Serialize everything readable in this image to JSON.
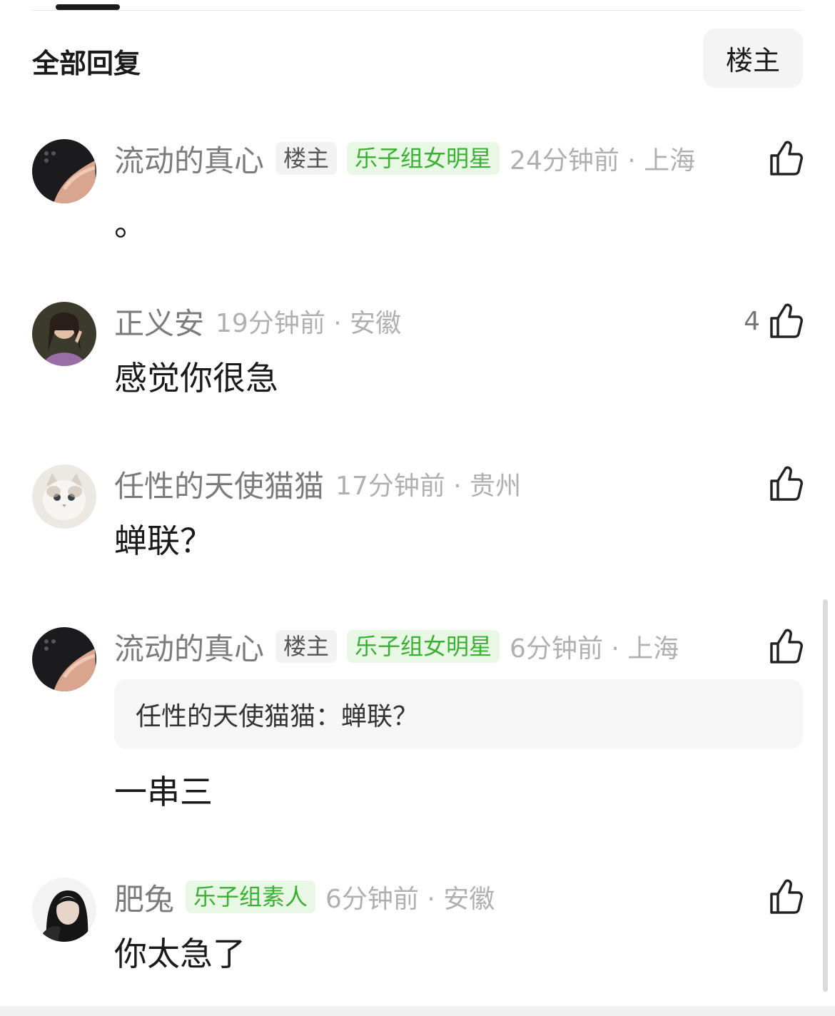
{
  "header": {
    "title": "全部回复",
    "filter_label": "楼主"
  },
  "comments": [
    {
      "username": "流动的真心",
      "badges": [
        "楼主",
        "乐子组女明星"
      ],
      "time": "24分钟前 · 上海",
      "likes": "",
      "text": "。"
    },
    {
      "username": "正义安",
      "badges": [],
      "time": "19分钟前 · 安徽",
      "likes": "4",
      "text": "感觉你很急"
    },
    {
      "username": "任性的天使猫猫",
      "badges": [],
      "time": "17分钟前 · 贵州",
      "likes": "",
      "text": "蝉联？"
    },
    {
      "username": "流动的真心",
      "badges": [
        "楼主",
        "乐子组女明星"
      ],
      "time": "6分钟前 · 上海",
      "likes": "",
      "quote": {
        "author": "任性的天使猫猫：",
        "text": "蝉联？"
      },
      "text": "一串三"
    },
    {
      "username": "肥兔",
      "badges": [
        "乐子组素人"
      ],
      "time": "6分钟前 · 安徽",
      "likes": "",
      "text": "你太急了"
    }
  ],
  "icons": {
    "like": "thumbs-up-icon"
  },
  "colors": {
    "badge_green_bg": "#e8f8e5",
    "badge_green_text": "#3ab034",
    "muted_text": "#b0b0b0",
    "username": "#7c7c7c"
  }
}
